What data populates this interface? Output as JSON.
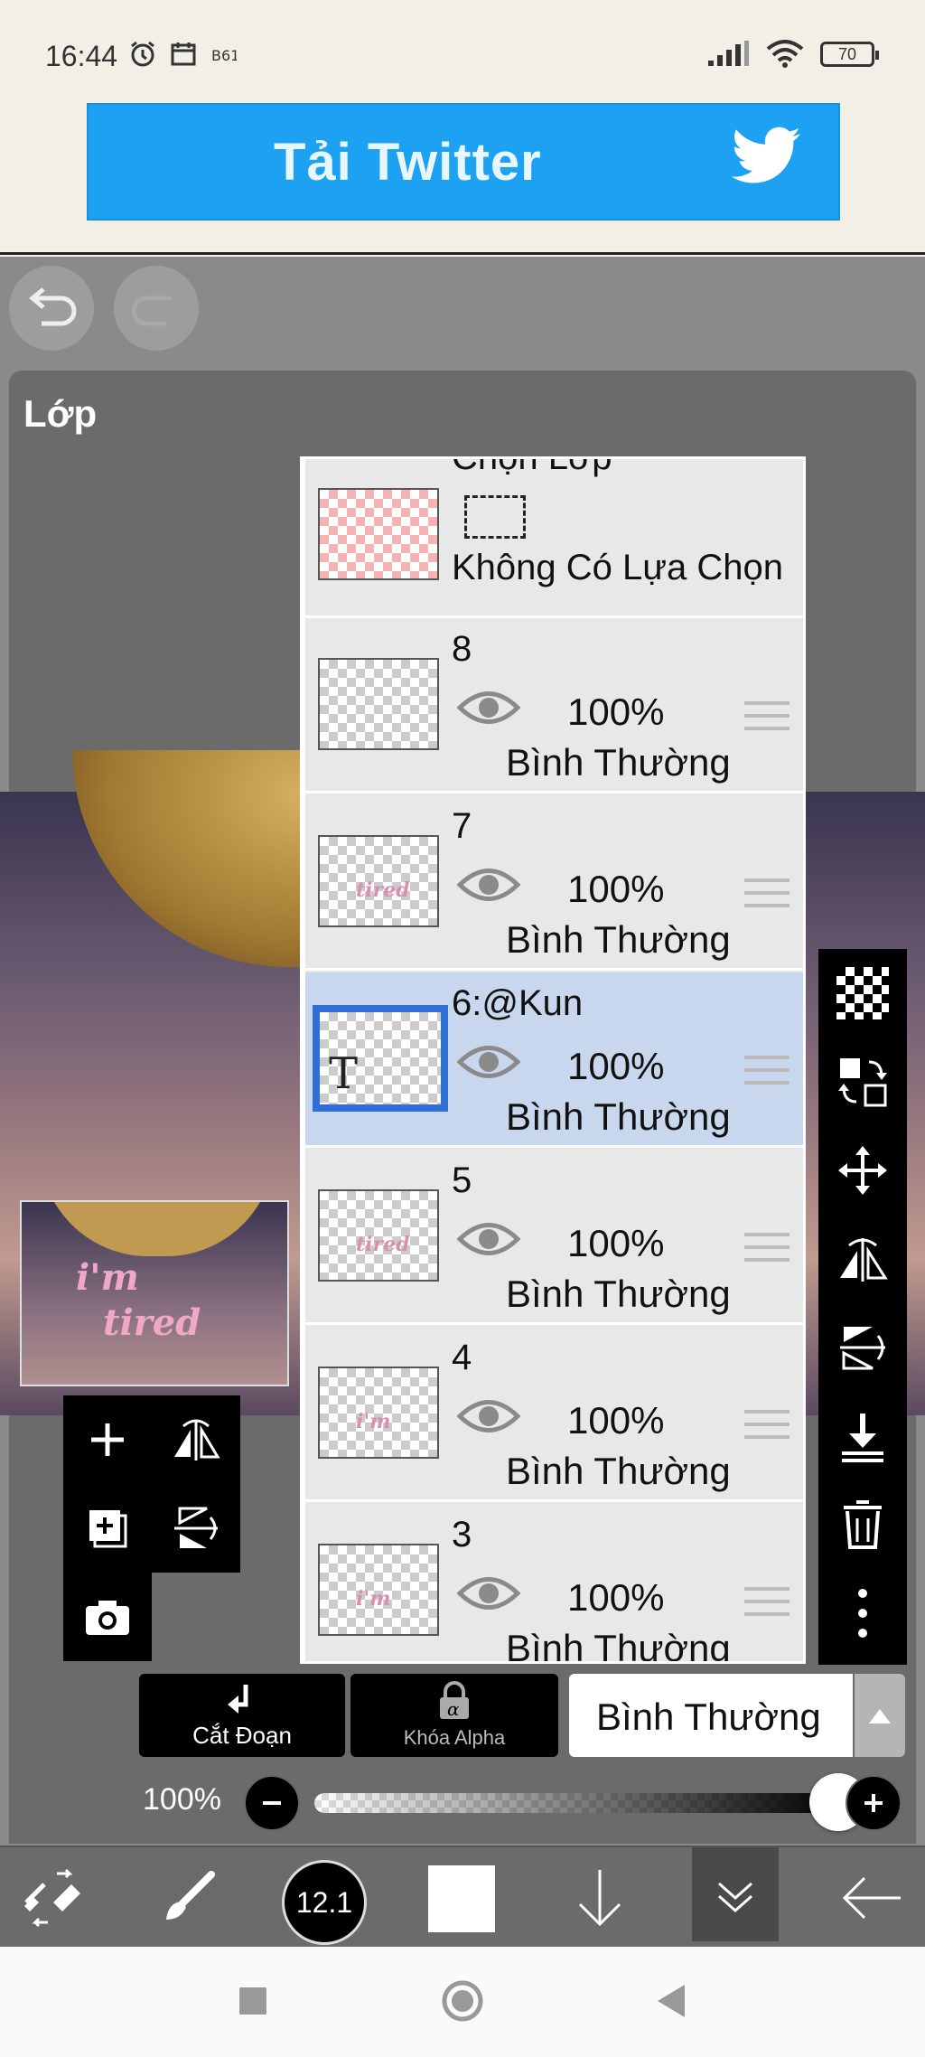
{
  "status": {
    "time": "16:44",
    "battery": "70",
    "left_icons": [
      "alarm-icon",
      "calendar-icon",
      "app-icon"
    ],
    "right_icons": [
      "signal-icon",
      "wifi-icon",
      "battery-icon"
    ]
  },
  "ad": {
    "text": "Tải Twitter",
    "icon": "twitter-bird-icon",
    "bg_color": "#1da1f2"
  },
  "panel": {
    "title": "Lớp"
  },
  "artwork": {
    "thumb_text_line1": "i'm",
    "thumb_text_line2": "tired"
  },
  "selection_layer": {
    "title": "Chọn Lớp",
    "status": "Không Có Lựa Chọn"
  },
  "layers": [
    {
      "name": "8",
      "opacity": "100%",
      "mode": "Bình Thường",
      "selected": false,
      "thumb": ""
    },
    {
      "name": "7",
      "opacity": "100%",
      "mode": "Bình Thường",
      "selected": false,
      "thumb": "tired"
    },
    {
      "name": "6:@Kun",
      "opacity": "100%",
      "mode": "Bình Thường",
      "selected": true,
      "thumb": "T"
    },
    {
      "name": "5",
      "opacity": "100%",
      "mode": "Bình Thường",
      "selected": false,
      "thumb": "tired"
    },
    {
      "name": "4",
      "opacity": "100%",
      "mode": "Bình Thường",
      "selected": false,
      "thumb": "i'm"
    },
    {
      "name": "3",
      "opacity": "100%",
      "mode": "Bình Thường",
      "selected": false,
      "thumb": "i'm"
    }
  ],
  "actions": {
    "clip_label": "Cắt Đoạn",
    "alpha_lock_label": "Khóa Alpha",
    "blend_mode": "Bình Thường"
  },
  "opacity": {
    "label": "100%",
    "value": 1.0
  },
  "toolbar": {
    "brush_size": "12.1",
    "color": "#ffffff"
  },
  "accent": "#2f6fd6"
}
